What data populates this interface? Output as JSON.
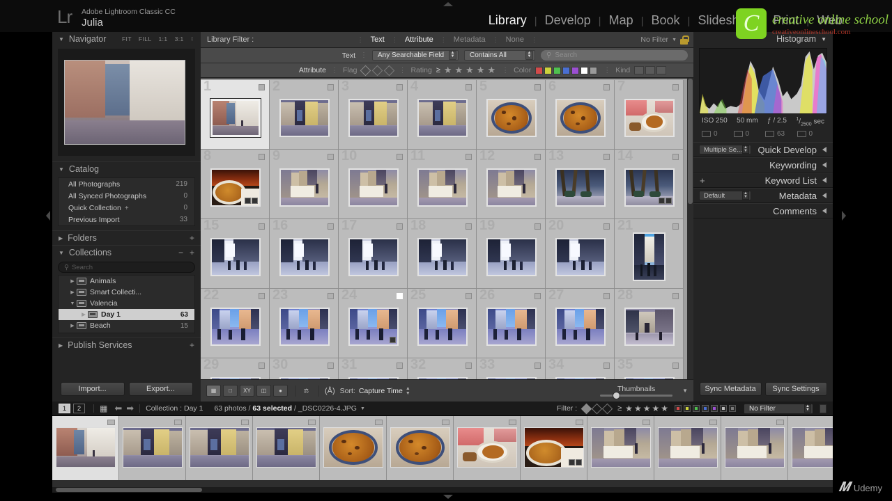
{
  "app": {
    "logo": "Lr",
    "product": "Adobe Lightroom Classic CC",
    "catalog": "Julia"
  },
  "modules": [
    {
      "label": "Library",
      "active": true
    },
    {
      "label": "Develop",
      "active": false
    },
    {
      "label": "Map",
      "active": false
    },
    {
      "label": "Book",
      "active": false
    },
    {
      "label": "Slideshow",
      "active": false
    },
    {
      "label": "Print",
      "active": false
    },
    {
      "label": "Web",
      "active": false
    }
  ],
  "navigator": {
    "title": "Navigator",
    "modes": [
      "FIT",
      "FILL",
      "1:1",
      "3:1"
    ]
  },
  "catalog_panel": {
    "title": "Catalog",
    "items": [
      {
        "label": "All Photographs",
        "count": "219"
      },
      {
        "label": "All Synced Photographs",
        "count": "0"
      },
      {
        "label": "Quick Collection",
        "plus": "+",
        "count": "0"
      },
      {
        "label": "Previous Import",
        "count": "33"
      }
    ]
  },
  "folders_panel": {
    "title": "Folders",
    "plus": "+"
  },
  "collections_panel": {
    "title": "Collections",
    "minus": "−",
    "plus": "+",
    "search_placeholder": "Search",
    "items": [
      {
        "label": "Animals",
        "count": "",
        "level": 1,
        "expanded": false,
        "selected": false
      },
      {
        "label": "Smart Collecti...",
        "count": "",
        "level": 1,
        "expanded": false,
        "selected": false
      },
      {
        "label": "Valencia",
        "count": "",
        "level": 1,
        "expanded": true,
        "selected": false
      },
      {
        "label": "Day 1",
        "count": "63",
        "level": 2,
        "expanded": false,
        "selected": true
      },
      {
        "label": "Beach",
        "count": "15",
        "level": 1,
        "expanded": false,
        "selected": false
      }
    ]
  },
  "publish_panel": {
    "title": "Publish Services",
    "plus": "+"
  },
  "left_buttons": {
    "import": "Import...",
    "export": "Export..."
  },
  "library_filter": {
    "label": "Library Filter :",
    "tabs": [
      {
        "label": "Text",
        "active": true
      },
      {
        "label": "Attribute",
        "active": true
      },
      {
        "label": "Metadata",
        "active": false
      },
      {
        "label": "None",
        "active": false
      }
    ],
    "preset": "No Filter",
    "lock_icon": "lock-icon",
    "text_row": {
      "label": "Text",
      "field_select": "Any Searchable Field",
      "rule_select": "Contains All",
      "search_placeholder": "Search"
    },
    "attribute_row": {
      "label": "Attribute",
      "flag_label": "Flag",
      "rating_label": "Rating",
      "rating_operator": "≥",
      "stars": 5,
      "color_label": "Color",
      "colors": [
        "#d24a4a",
        "#ccd23c",
        "#4fc04f",
        "#4a6fd2",
        "#9b4fd2",
        "#ffffff",
        "#9a9a9a"
      ],
      "kind_label": "Kind"
    }
  },
  "grid": {
    "cells": [
      {
        "n": "1",
        "checked": false,
        "badges": 0,
        "active": true,
        "portrait": false,
        "kind": "plaza"
      },
      {
        "n": "2",
        "checked": false,
        "badges": 0,
        "active": false,
        "portrait": false,
        "kind": "facade"
      },
      {
        "n": "3",
        "checked": false,
        "badges": 0,
        "active": false,
        "portrait": false,
        "kind": "facade"
      },
      {
        "n": "4",
        "checked": false,
        "badges": 0,
        "active": false,
        "portrait": false,
        "kind": "facade"
      },
      {
        "n": "5",
        "checked": false,
        "badges": 0,
        "active": false,
        "portrait": false,
        "kind": "paella"
      },
      {
        "n": "6",
        "checked": false,
        "badges": 0,
        "active": false,
        "portrait": false,
        "kind": "paella"
      },
      {
        "n": "7",
        "checked": false,
        "badges": 0,
        "active": false,
        "portrait": false,
        "kind": "table"
      },
      {
        "n": "8",
        "checked": false,
        "badges": 2,
        "active": false,
        "portrait": false,
        "kind": "paelladark"
      },
      {
        "n": "9",
        "checked": false,
        "badges": 0,
        "active": false,
        "portrait": false,
        "kind": "arcade"
      },
      {
        "n": "10",
        "checked": false,
        "badges": 0,
        "active": false,
        "portrait": false,
        "kind": "arcade"
      },
      {
        "n": "11",
        "checked": false,
        "badges": 0,
        "active": false,
        "portrait": false,
        "kind": "arcade"
      },
      {
        "n": "12",
        "checked": false,
        "badges": 0,
        "active": false,
        "portrait": false,
        "kind": "arcade"
      },
      {
        "n": "13",
        "checked": false,
        "badges": 0,
        "active": false,
        "portrait": false,
        "kind": "trees"
      },
      {
        "n": "14",
        "checked": false,
        "badges": 2,
        "active": false,
        "portrait": false,
        "kind": "trees"
      },
      {
        "n": "15",
        "checked": false,
        "badges": 0,
        "active": false,
        "portrait": false,
        "kind": "street"
      },
      {
        "n": "16",
        "checked": false,
        "badges": 0,
        "active": false,
        "portrait": false,
        "kind": "street"
      },
      {
        "n": "17",
        "checked": false,
        "badges": 0,
        "active": false,
        "portrait": false,
        "kind": "street"
      },
      {
        "n": "18",
        "checked": false,
        "badges": 0,
        "active": false,
        "portrait": false,
        "kind": "street"
      },
      {
        "n": "19",
        "checked": false,
        "badges": 0,
        "active": false,
        "portrait": false,
        "kind": "street"
      },
      {
        "n": "20",
        "checked": false,
        "badges": 0,
        "active": false,
        "portrait": false,
        "kind": "street"
      },
      {
        "n": "21",
        "checked": false,
        "badges": 0,
        "active": false,
        "portrait": true,
        "kind": "cathedral"
      },
      {
        "n": "22",
        "checked": false,
        "badges": 0,
        "active": false,
        "portrait": false,
        "kind": "square"
      },
      {
        "n": "23",
        "checked": false,
        "badges": 0,
        "active": false,
        "portrait": false,
        "kind": "square"
      },
      {
        "n": "24",
        "checked": true,
        "badges": 1,
        "active": false,
        "portrait": false,
        "kind": "square"
      },
      {
        "n": "25",
        "checked": false,
        "badges": 0,
        "active": false,
        "portrait": false,
        "kind": "square"
      },
      {
        "n": "26",
        "checked": false,
        "badges": 0,
        "active": false,
        "portrait": false,
        "kind": "square"
      },
      {
        "n": "27",
        "checked": false,
        "badges": 0,
        "active": false,
        "portrait": false,
        "kind": "square"
      },
      {
        "n": "28",
        "checked": false,
        "badges": 0,
        "active": false,
        "portrait": false,
        "kind": "church"
      },
      {
        "n": "29",
        "checked": false,
        "badges": 0,
        "active": false,
        "portrait": false,
        "kind": "square"
      },
      {
        "n": "30",
        "checked": false,
        "badges": 0,
        "active": false,
        "portrait": false,
        "kind": "square"
      },
      {
        "n": "31",
        "checked": false,
        "badges": 0,
        "active": false,
        "portrait": false,
        "kind": "square"
      },
      {
        "n": "32",
        "checked": false,
        "badges": 0,
        "active": false,
        "portrait": false,
        "kind": "square"
      },
      {
        "n": "33",
        "checked": false,
        "badges": 0,
        "active": false,
        "portrait": false,
        "kind": "square"
      },
      {
        "n": "34",
        "checked": false,
        "badges": 0,
        "active": false,
        "portrait": false,
        "kind": "square"
      },
      {
        "n": "35",
        "checked": false,
        "badges": 0,
        "active": false,
        "portrait": false,
        "kind": "square"
      }
    ]
  },
  "toolbar": {
    "view_buttons": [
      "grid-view-icon",
      "loupe-view-icon",
      "compare-view-icon",
      "survey-view-icon",
      "people-view-icon"
    ],
    "paint_icon": "spray-can-icon",
    "sort_direction_icon": "az-sort-icon",
    "sort_label": "Sort:",
    "sort_value": "Capture Time",
    "thumbnails_label": "Thumbnails"
  },
  "right_panel": {
    "histogram_title": "Histogram",
    "exif": {
      "iso": "ISO 250",
      "focal": "50 mm",
      "aperture": "ƒ / 2.5",
      "shutter_num": "1",
      "shutter_den": "2500",
      "shutter_unit": "sec"
    },
    "counts": [
      {
        "icon": "original-photo-icon",
        "value": "0"
      },
      {
        "icon": "virtual-copy-icon",
        "value": "0"
      },
      {
        "icon": "photo-count-icon",
        "value": "63"
      },
      {
        "icon": "video-count-icon",
        "value": "0"
      }
    ],
    "sections": [
      {
        "title": "Quick Develop",
        "control": "Multiple Se...",
        "control_type": "combo"
      },
      {
        "title": "Keywording",
        "control": null,
        "control_type": null
      },
      {
        "title": "Keyword List",
        "control": "+",
        "control_type": "plus"
      },
      {
        "title": "Metadata",
        "control": "Default",
        "control_type": "combo"
      },
      {
        "title": "Comments",
        "control": null,
        "control_type": null
      }
    ],
    "buttons": {
      "sync_metadata": "Sync Metadata",
      "sync_settings": "Sync Settings"
    }
  },
  "filmstrip_bar": {
    "page_buttons": [
      "1",
      "2"
    ],
    "grid_icon": "grid-icon",
    "back_icon": "back-arrow-icon",
    "forward_icon": "forward-arrow-icon",
    "source": "Collection : Day 1",
    "photo_count": "63 photos /",
    "selected": "63 selected",
    "filename": "/ _DSC0226-4.JPG",
    "filter_label": "Filter :",
    "filter_stars": 5,
    "filter_operator": "≥",
    "filter_colors": [
      "#d24a4a",
      "#ccd23c",
      "#4fc04f",
      "#4a6fd2",
      "#9b4fd2",
      "#bdbdbd",
      "#7a7a7a"
    ],
    "filter_preset": "No Filter"
  },
  "filmstrip": {
    "cells": [
      {
        "kind": "plaza",
        "active": true,
        "badges": 0
      },
      {
        "kind": "facade",
        "active": false,
        "badges": 0
      },
      {
        "kind": "facade",
        "active": false,
        "badges": 0
      },
      {
        "kind": "facade",
        "active": false,
        "badges": 0
      },
      {
        "kind": "paella",
        "active": false,
        "badges": 0
      },
      {
        "kind": "paella",
        "active": false,
        "badges": 0
      },
      {
        "kind": "table",
        "active": false,
        "badges": 0
      },
      {
        "kind": "paelladark",
        "active": false,
        "badges": 2
      },
      {
        "kind": "arcade",
        "active": false,
        "badges": 0
      },
      {
        "kind": "arcade",
        "active": false,
        "badges": 0
      },
      {
        "kind": "arcade",
        "active": false,
        "badges": 0
      },
      {
        "kind": "arcade",
        "active": false,
        "badges": 0
      }
    ]
  },
  "watermarks": {
    "brand_letter": "C",
    "brand_text": "creative online school",
    "brand_url": "creativeonlineschool.com",
    "udemy": "Udemy"
  }
}
